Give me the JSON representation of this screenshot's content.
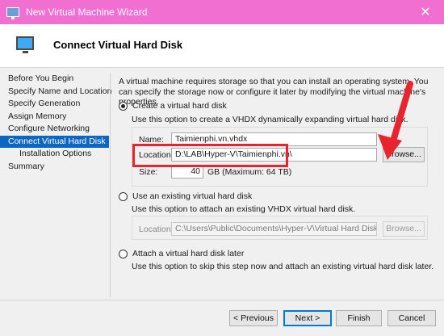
{
  "window": {
    "title": "New Virtual Machine Wizard",
    "close_glyph": "✕"
  },
  "header": {
    "title": "Connect Virtual Hard Disk"
  },
  "sidebar": {
    "items": [
      {
        "label": "Before You Begin"
      },
      {
        "label": "Specify Name and Location"
      },
      {
        "label": "Specify Generation"
      },
      {
        "label": "Assign Memory"
      },
      {
        "label": "Configure Networking"
      },
      {
        "label": "Connect Virtual Hard Disk"
      },
      {
        "label": "Installation Options"
      },
      {
        "label": "Summary"
      }
    ]
  },
  "main": {
    "intro": "A virtual machine requires storage so that you can install an operating system. You can specify the storage now or configure it later by modifying the virtual machine's properties.",
    "create": {
      "label": "Create a virtual hard disk",
      "desc": "Use this option to create a VHDX dynamically expanding virtual hard disk.",
      "name_label": "Name:",
      "name_value": "Taimienphi.vn.vhdx",
      "location_label": "Location:",
      "location_value": "D:\\LAB\\Hyper-V\\Taimienphi.vn\\",
      "browse_label": "Browse...",
      "size_label": "Size:",
      "size_value": "40",
      "size_unit": "GB (Maximum: 64 TB)"
    },
    "existing": {
      "label": "Use an existing virtual hard disk",
      "desc": "Use this option to attach an existing VHDX virtual hard disk.",
      "location_label": "Location:",
      "location_value": "C:\\Users\\Public\\Documents\\Hyper-V\\Virtual Hard Disks\\",
      "browse_label": "Browse..."
    },
    "later": {
      "label": "Attach a virtual hard disk later",
      "desc": "Use this option to skip this step now and attach an existing virtual hard disk later."
    }
  },
  "footer": {
    "previous": "< Previous",
    "next": "Next >",
    "finish": "Finish",
    "cancel": "Cancel"
  },
  "colors": {
    "titlebar": "#f26fd2",
    "selection": "#0c67c2",
    "annotation": "#e8242f"
  }
}
